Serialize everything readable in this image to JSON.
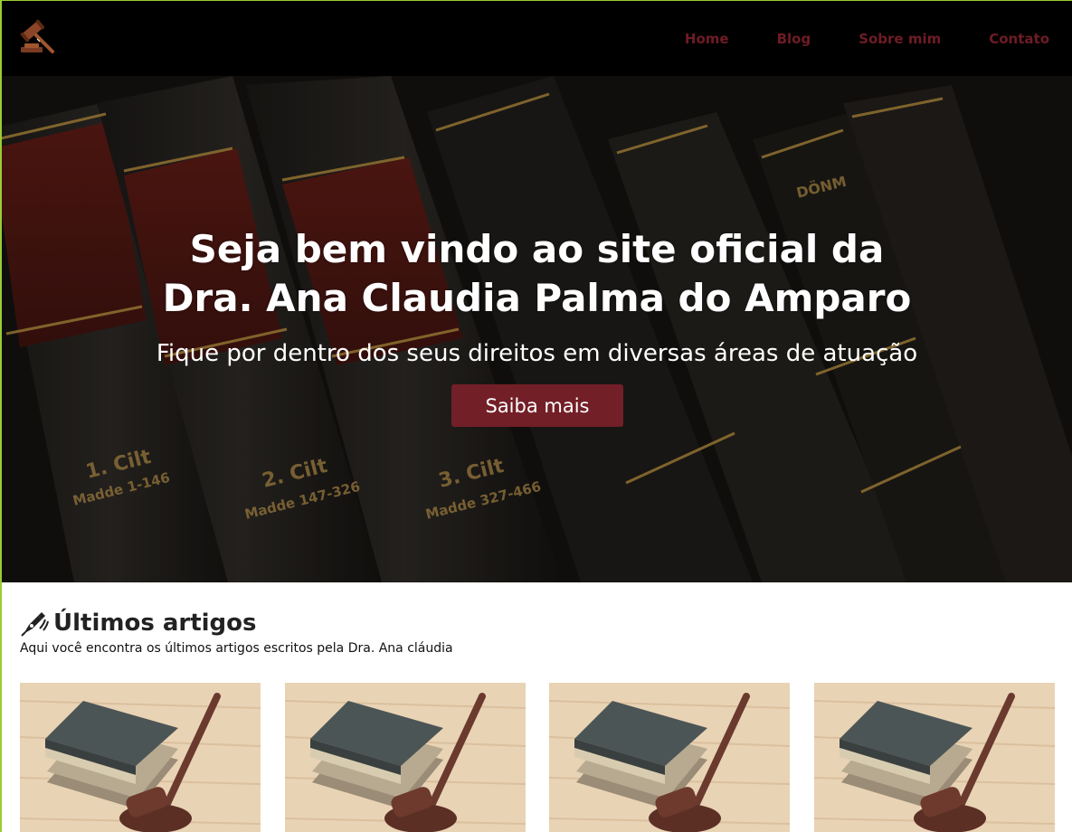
{
  "header": {
    "logo_icon": "gavel-icon",
    "nav": [
      {
        "label": "Home"
      },
      {
        "label": "Blog"
      },
      {
        "label": "Sobre mim"
      },
      {
        "label": "Contato"
      }
    ],
    "nav_color": "#6e1c25"
  },
  "hero": {
    "title_line1": "Seja bem vindo ao site oficial da",
    "title_line2": "Dra. Ana Claudia Palma do Amparo",
    "subtitle": "Fique por dentro dos seus direitos em diversas áreas de atuação",
    "button_label": "Saiba mais",
    "button_color": "#731f27"
  },
  "articles": {
    "icon": "fountain-pen-icon",
    "title": "Últimos artigos",
    "description": "Aqui você encontra os últimos artigos escritos pela Dra. Ana cláudia",
    "cards": [
      {
        "image": "book-gavel-image"
      },
      {
        "image": "book-gavel-image"
      },
      {
        "image": "book-gavel-image"
      },
      {
        "image": "book-gavel-image"
      }
    ]
  }
}
